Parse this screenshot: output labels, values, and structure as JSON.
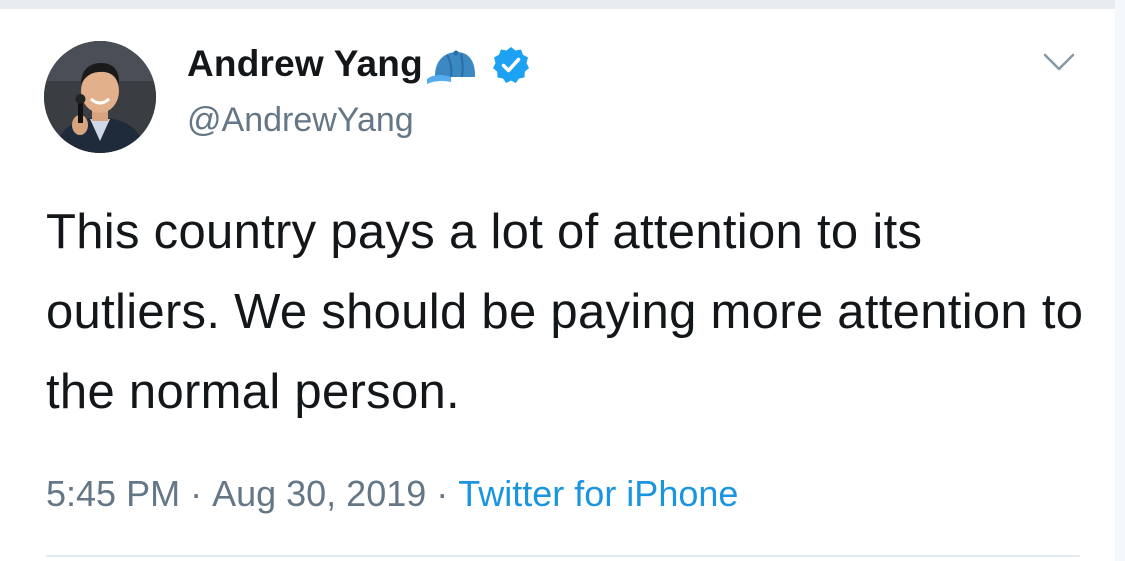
{
  "tweet": {
    "display_name": "Andrew Yang",
    "handle": "@AndrewYang",
    "text": "This country pays a lot of attention to its outliers. We should be paying more attention to the normal person.",
    "time": "5:45 PM",
    "separator": "·",
    "date": "Aug 30, 2019",
    "source": "Twitter for iPhone"
  },
  "icons": {
    "avatar": "profile-photo",
    "cap": "blue-baseball-cap-emoji",
    "verified": "verified-badge",
    "more": "chevron-down"
  },
  "colors": {
    "text": "#14171a",
    "secondary": "#657786",
    "link": "#1b95e0",
    "verified": "#1da1f2",
    "divider": "#e6ecf0"
  }
}
